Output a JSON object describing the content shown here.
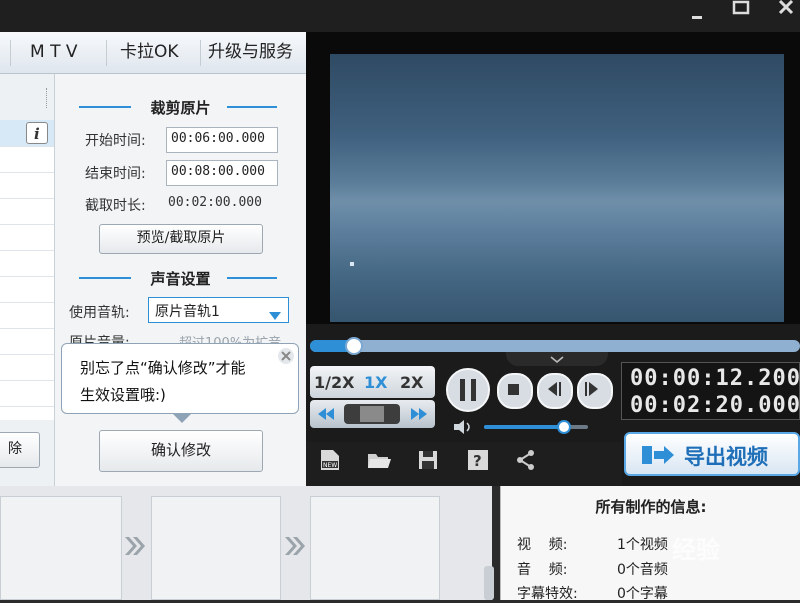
{
  "tabs": [
    {
      "label": "M T V"
    },
    {
      "label": "卡拉OK"
    },
    {
      "label": "升级与服务"
    }
  ],
  "crop_section": {
    "title": "裁剪原片",
    "start_label": "开始时间:",
    "start_value": "00:06:00.000",
    "end_label": "结束时间:",
    "end_value": "00:08:00.000",
    "duration_label": "截取时长:",
    "duration_value": "00:02:00.000",
    "preview_button": "预览/截取原片"
  },
  "audio_section": {
    "title": "声音设置",
    "track_label": "使用音轨:",
    "track_value": "原片音轨1",
    "volume_label": "原片音量:",
    "volume_hint": "超过100%为扩音"
  },
  "tooltip": {
    "text_line1": "别忘了点“确认修改”才能",
    "text_line2": "生效设置哦:)"
  },
  "confirm_button": "确认修改",
  "left_button_partial": "除",
  "player": {
    "speeds": [
      "1/2X",
      "1X",
      "2X"
    ],
    "current_time": "00:00:12.200",
    "total_time": "00:02:20.000",
    "seek_progress": 0.09,
    "volume_level": 0.77
  },
  "export_button": "导出视频",
  "info_panel": {
    "title": "所有制作的信息:",
    "rows": [
      {
        "label": "视    频:",
        "value": "1个视频"
      },
      {
        "label": "音    频:",
        "value": "0个音频"
      },
      {
        "label": "字幕特效:",
        "value": "0个字幕"
      }
    ]
  },
  "watermark": "经验"
}
